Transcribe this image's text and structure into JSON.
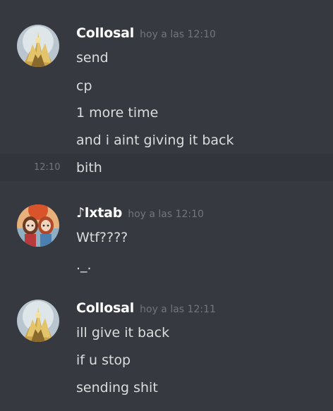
{
  "groups": [
    {
      "username": "Collosal",
      "timestamp": "hoy a las 12:10",
      "avatar_icon": "golden-statue-avatar",
      "messages": [
        "send",
        "cp",
        "1 more time",
        "and i aint giving it back",
        "bith"
      ],
      "hover_timestamp": "12:10"
    },
    {
      "username": "♪lxtab",
      "timestamp": "hoy a las 12:10",
      "avatar_icon": "anime-girls-avatar",
      "messages": [
        "Wtf????",
        "._."
      ]
    },
    {
      "username": "Collosal",
      "timestamp": "hoy a las 12:11",
      "avatar_icon": "golden-statue-avatar",
      "messages": [
        "ill give it back",
        "if u stop",
        "sending shit"
      ]
    }
  ]
}
